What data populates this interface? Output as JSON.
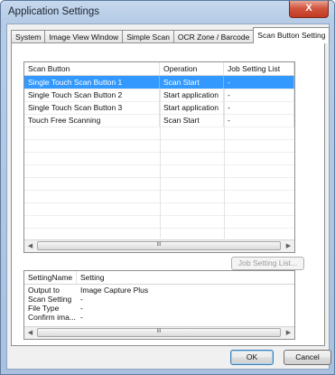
{
  "window": {
    "title": "Application Settings",
    "close_glyph": "X"
  },
  "tabs": [
    {
      "label": "System",
      "active": false
    },
    {
      "label": "Image View Window",
      "active": false
    },
    {
      "label": "Simple Scan",
      "active": false
    },
    {
      "label": "OCR Zone / Barcode",
      "active": false
    },
    {
      "label": "Scan Button Setting",
      "active": true
    }
  ],
  "scan_grid": {
    "headers": [
      "Scan Button",
      "Operation",
      "Job Setting List"
    ],
    "rows": [
      {
        "name": "Single Touch Scan Button 1",
        "operation": "Scan Start",
        "job": "-",
        "selected": true
      },
      {
        "name": "Single Touch Scan Button 2",
        "operation": "Start application",
        "job": "-",
        "selected": false
      },
      {
        "name": "Single Touch Scan Button 3",
        "operation": "Start application",
        "job": "-",
        "selected": false
      },
      {
        "name": "Touch Free Scanning",
        "operation": "Scan Start",
        "job": "-",
        "selected": false
      }
    ],
    "scroll_thumb_glyph": "III"
  },
  "job_setting_list_button": "Job Setting List...",
  "details_grid": {
    "headers": [
      "SettingName",
      "Setting"
    ],
    "rows": [
      {
        "name": "Output to",
        "value": "Image Capture Plus"
      },
      {
        "name": "Scan Setting",
        "value": "-"
      },
      {
        "name": "File Type",
        "value": "-"
      },
      {
        "name": "Confirm ima...",
        "value": "-"
      }
    ],
    "scroll_thumb_glyph": "III"
  },
  "footer": {
    "ok": "OK",
    "cancel": "Cancel"
  },
  "colors": {
    "selection": "#3399ff",
    "title_bar": "#b6cce6",
    "close_button": "#c8432c"
  }
}
